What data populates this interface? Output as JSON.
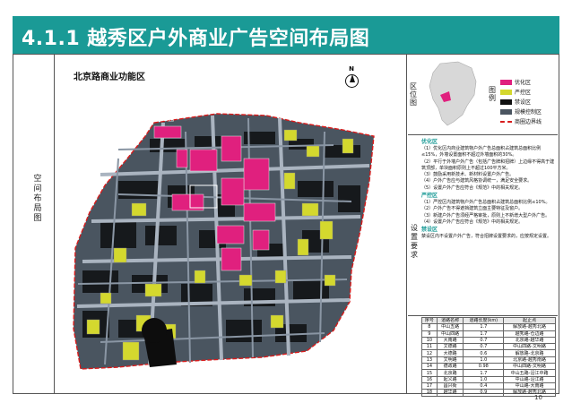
{
  "header": {
    "title": "4.1.1 越秀区户外商业广告空间布局图"
  },
  "side_label": "空间布局图",
  "map": {
    "title": "北京路商业功能区",
    "north_label": "N",
    "street_labels": [
      "大新公园",
      "高第街"
    ]
  },
  "right_panel": {
    "location_label": "区位图",
    "legend_label": "图例",
    "legend": [
      {
        "label": "优化区",
        "color": "#e0207e"
      },
      {
        "label": "严控区",
        "color": "#d4d82e"
      },
      {
        "label": "禁设区",
        "color": "#101010"
      },
      {
        "label": "规模控制区",
        "color": "#4a5560"
      },
      {
        "label": "商圈边界线",
        "color": "#d81c1c"
      }
    ],
    "requirements_label": "设置要求",
    "requirements": [
      {
        "heading": "优化区",
        "lines": [
          "（1）优化区内商业建筑物户外广告总面积占建筑总面积比例≤15%，外墙设置面积不超过外墙面积的30%。",
          "（2）平行于外墙户外广告（包括广告牌和招牌）上边缘不得高于建筑顶部，单块面积原则上不超过100平方米。",
          "（3）鼓励采用新技术、新材料设置户外广告。",
          "（4）户外广告应与建筑风格协调统一，满足安全要求。",
          "（5）设置户外广告应符合《规范》中的相关规定。"
        ]
      },
      {
        "heading": "严控区",
        "lines": [
          "（1）严控区内建筑物户外广告总面积占建筑总面积比例≤10%。",
          "（2）户外广告不得遮挡建筑立面主要特征及窗户。",
          "（3）新建户外广告须经严格审批，原则上不新增大型户外广告。",
          "（4）设置户外广告应符合《规范》中的相关规定。"
        ]
      },
      {
        "heading": "禁设区",
        "lines": [
          "禁设区内不设置户外广告，符合招牌设置要求的，应按规定设置。"
        ]
      }
    ],
    "road_table": {
      "headers": [
        "序号",
        "道路名称",
        "道路长度(km)",
        "起止点"
      ],
      "rows": [
        [
          "8",
          "中山五路",
          "1.7",
          "解放路-越秀北路"
        ],
        [
          "9",
          "中山四路",
          "1.7",
          "越秀路-仓边路"
        ],
        [
          "10",
          "大南路",
          "0.7",
          "北京路-越华路"
        ],
        [
          "11",
          "文德路",
          "0.7",
          "中山四路-文明路"
        ],
        [
          "12",
          "大德路",
          "0.6",
          "解放路-北京路"
        ],
        [
          "13",
          "文明路",
          "1.0",
          "北京路-越秀南路"
        ],
        [
          "14",
          "德政路",
          "0.98",
          "中山四路-文明路"
        ],
        [
          "15",
          "北京路",
          "1.7",
          "中山五路-沿江中路"
        ],
        [
          "16",
          "起义路",
          "1.0",
          "中山路-沿江路"
        ],
        [
          "17",
          "昌兴街",
          "0.4",
          "中山路-大南路"
        ],
        [
          "18",
          "越华路",
          "0.9",
          "解放路-越秀北路"
        ]
      ]
    }
  },
  "page_number": "10"
}
